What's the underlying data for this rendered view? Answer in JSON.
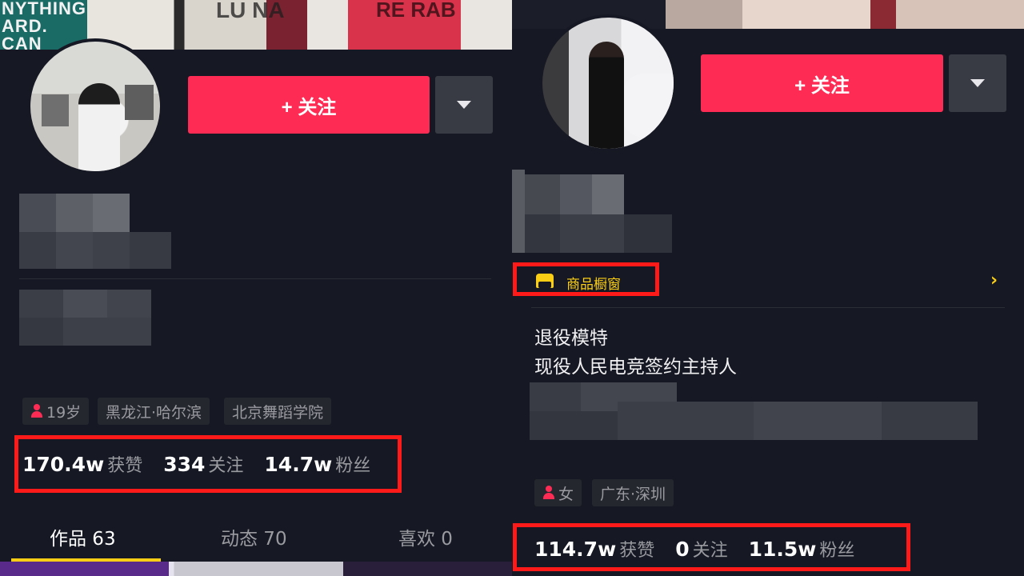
{
  "left_profile": {
    "follow_label": "+ 关注",
    "cover_text_1": [
      "NYTHING",
      "ARD.",
      "CAN"
    ],
    "cover_text_2": "LU NA",
    "cover_text_3": "RE RAB",
    "tags": [
      {
        "label": "19岁",
        "icon": "female-person-icon"
      },
      {
        "label": "黑龙江·哈尔滨"
      },
      {
        "label": "北京舞蹈学院"
      }
    ],
    "stats": {
      "likes_value": "170.4w",
      "likes_label": "获赞",
      "following_value": "334",
      "following_label": "关注",
      "followers_value": "14.7w",
      "followers_label": "粉丝"
    },
    "tabs": [
      {
        "label": "作品 63",
        "active": true
      },
      {
        "label": "动态 70",
        "active": false
      },
      {
        "label": "喜欢 0",
        "active": false
      }
    ]
  },
  "right_profile": {
    "follow_label": "+ 关注",
    "shop_window_label": "商品橱窗",
    "shop_chevron": "›",
    "bio_lines": [
      "退役模特",
      "现役人民电竞签约主持人"
    ],
    "tags": [
      {
        "label": "女",
        "icon": "female-person-icon"
      },
      {
        "label": "广东·深圳"
      }
    ],
    "stats": {
      "likes_value": "114.7w",
      "likes_label": "获赞",
      "following_value": "0",
      "following_label": "关注",
      "followers_value": "11.5w",
      "followers_label": "粉丝"
    }
  },
  "colors": {
    "background": "#161823",
    "accent_red": "#fe2c55",
    "highlight_box": "#ff1a1a",
    "shop_yellow": "#face15",
    "tag_bg": "#25272f"
  }
}
